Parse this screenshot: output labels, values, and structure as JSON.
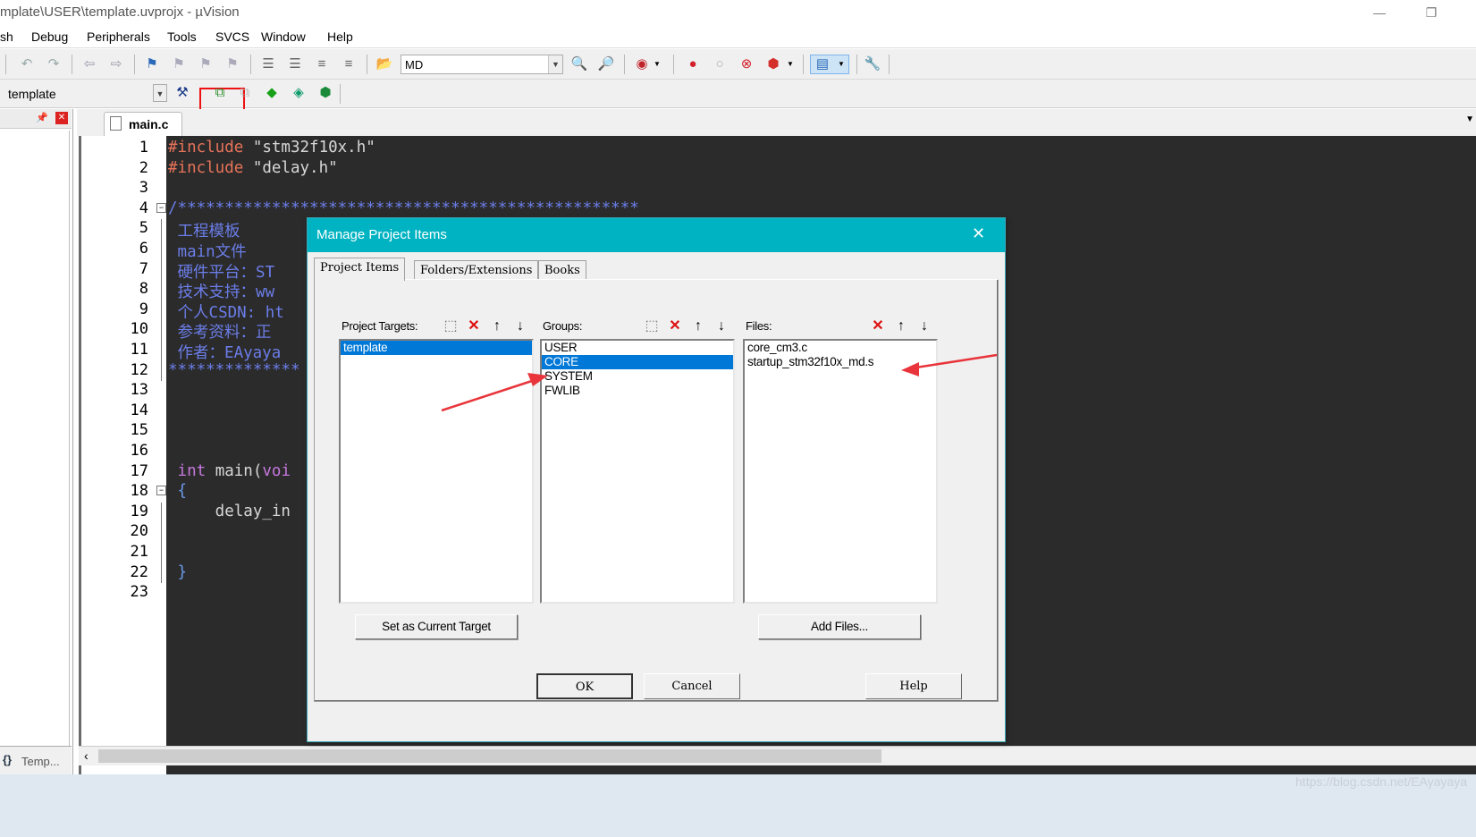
{
  "window": {
    "title": "mplate\\USER\\template.uvprojx - µVision",
    "minimize": "—",
    "restore": "❐"
  },
  "menu": [
    "sh",
    "Debug",
    "Peripherals",
    "Tools",
    "SVCS",
    "Window",
    "Help"
  ],
  "toolbar": {
    "md_label": "MD",
    "target_combo": "template"
  },
  "left_panel": {
    "pin": "📌",
    "close": "✕",
    "tab_label": "Temp..."
  },
  "editor": {
    "file_tab": "main.c",
    "line_numbers": [
      "1",
      "2",
      "3",
      "4",
      "5",
      "6",
      "7",
      "8",
      "9",
      "10",
      "11",
      "12",
      "13",
      "14",
      "15",
      "16",
      "17",
      "18",
      "19",
      "20",
      "21",
      "22",
      "23"
    ],
    "lines": [
      {
        "parts": [
          {
            "t": "#include ",
            "c": "#e8735a"
          },
          {
            "t": "\"stm32f10x.h\"",
            "c": "#d7d7d7"
          }
        ]
      },
      {
        "parts": [
          {
            "t": "#include ",
            "c": "#e8735a"
          },
          {
            "t": "\"delay.h\"",
            "c": "#d7d7d7"
          }
        ]
      },
      {
        "parts": []
      },
      {
        "parts": [
          {
            "t": "/*************************************************",
            "c": "#6b7de8"
          }
        ]
      },
      {
        "parts": [
          {
            "t": " 工程模板",
            "c": "#6b7de8"
          }
        ]
      },
      {
        "parts": [
          {
            "t": " main文件",
            "c": "#6b7de8"
          }
        ]
      },
      {
        "parts": [
          {
            "t": " 硬件平台：ST",
            "c": "#6b7de8"
          }
        ]
      },
      {
        "parts": [
          {
            "t": " 技术支持：ww",
            "c": "#6b7de8"
          }
        ]
      },
      {
        "parts": [
          {
            "t": " 个人CSDN: ht",
            "c": "#6b7de8"
          }
        ]
      },
      {
        "parts": [
          {
            "t": " 参考资料：正",
            "c": "#6b7de8"
          }
        ]
      },
      {
        "parts": [
          {
            "t": " 作者：EAyaya",
            "c": "#6b7de8"
          }
        ]
      },
      {
        "parts": [
          {
            "t": "**************",
            "c": "#6b7de8"
          }
        ]
      },
      {
        "parts": []
      },
      {
        "parts": []
      },
      {
        "parts": []
      },
      {
        "parts": []
      },
      {
        "parts": [
          {
            "t": " int",
            "c": "#c678dd"
          },
          {
            "t": " main(",
            "c": "#d7d7d7"
          },
          {
            "t": "voi",
            "c": "#c678dd"
          }
        ]
      },
      {
        "parts": [
          {
            "t": " {",
            "c": "#6b9ae8"
          }
        ]
      },
      {
        "parts": [
          {
            "t": "     delay_in",
            "c": "#d7d7d7"
          }
        ]
      },
      {
        "parts": []
      },
      {
        "parts": []
      },
      {
        "parts": [
          {
            "t": " }",
            "c": "#6b9ae8"
          }
        ]
      },
      {
        "parts": []
      }
    ]
  },
  "dialog": {
    "title": "Manage Project Items",
    "close": "✕",
    "tabs": [
      "Project Items",
      "Folders/Extensions",
      "Books"
    ],
    "targets": {
      "header": "Project Targets:",
      "items": [
        "template"
      ],
      "selected": 0,
      "button": "Set as Current Target"
    },
    "groups": {
      "header": "Groups:",
      "items": [
        "USER",
        "CORE",
        "SYSTEM",
        "FWLIB"
      ],
      "selected": 1
    },
    "files": {
      "header": "Files:",
      "items": [
        "core_cm3.c",
        "startup_stm32f10x_md.s"
      ],
      "button": "Add Files..."
    },
    "ok": "OK",
    "cancel": "Cancel",
    "help": "Help"
  },
  "watermark": "https://blog.csdn.net/EAyayaya",
  "colors": {
    "dialog_title": "#00b3c2",
    "selection": "#0078d7",
    "arrow": "#e8343a",
    "editor_bg": "#2b2b2b"
  }
}
